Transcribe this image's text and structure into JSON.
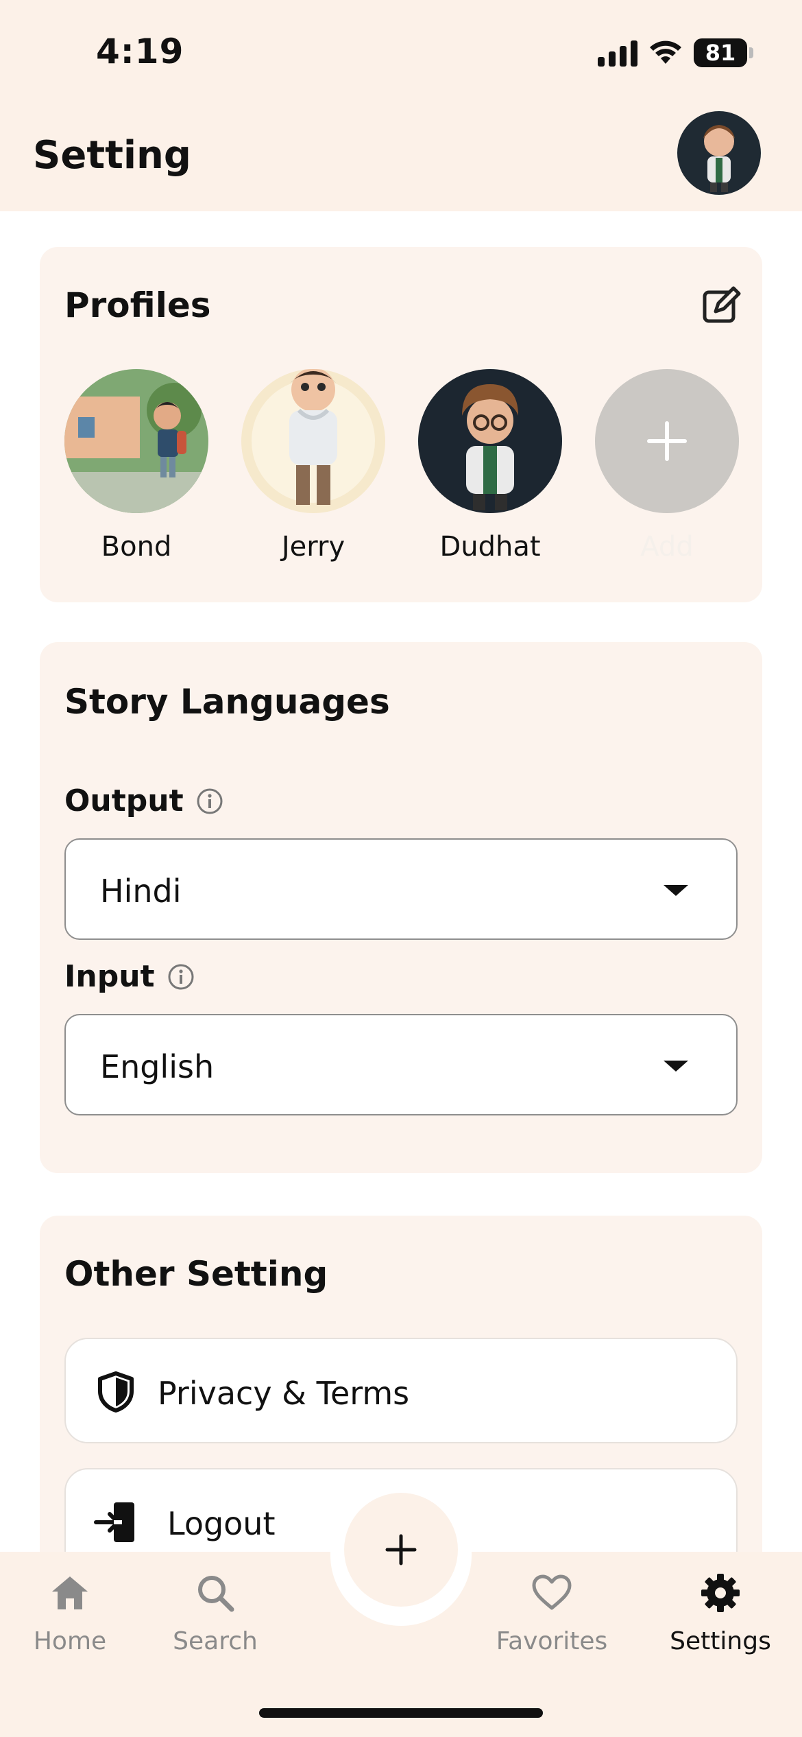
{
  "status_bar": {
    "time": "4:19",
    "battery": "81"
  },
  "header": {
    "title": "Setting",
    "avatar": "profile-avatar"
  },
  "profiles_card": {
    "title": "Profiles",
    "profiles": [
      {
        "name": "Bond"
      },
      {
        "name": "Jerry"
      },
      {
        "name": "Dudhat"
      },
      {
        "name": "Add"
      }
    ]
  },
  "languages_card": {
    "title": "Story Languages",
    "output": {
      "label": "Output",
      "value": "Hindi"
    },
    "input": {
      "label": "Input",
      "value": "English"
    }
  },
  "other_card": {
    "title": "Other Setting",
    "items": [
      {
        "label": "Privacy & Terms",
        "icon": "shield-icon"
      },
      {
        "label": "Logout",
        "icon": "logout-icon"
      }
    ]
  },
  "bottom_nav": {
    "items": [
      {
        "label": "Home",
        "icon": "home-icon",
        "active": false
      },
      {
        "label": "Search",
        "icon": "search-icon",
        "active": false
      },
      {
        "label": "Favorites",
        "icon": "heart-icon",
        "active": false
      },
      {
        "label": "Settings",
        "icon": "gear-icon",
        "active": true
      }
    ],
    "fab_icon": "plus-icon"
  },
  "colors": {
    "background": "#fcf1e8",
    "card": "#fcf3ed",
    "text": "#111111",
    "muted": "#8a8a8a",
    "add_circle": "#cbc8c4"
  }
}
